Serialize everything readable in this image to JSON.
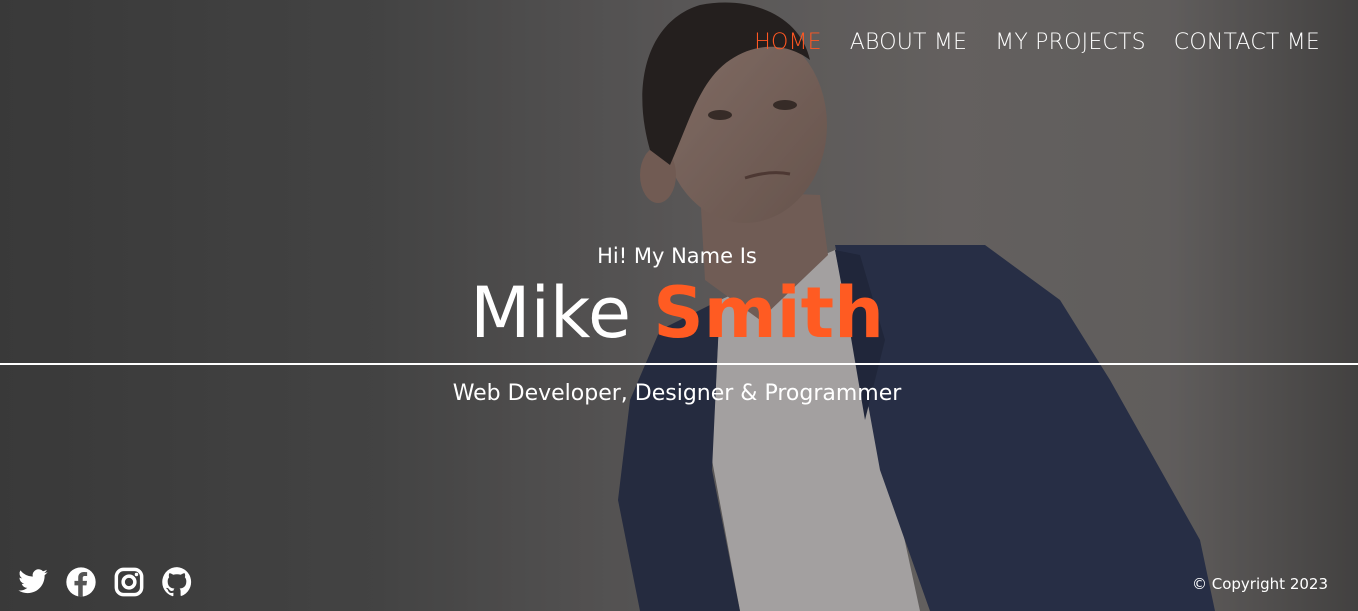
{
  "nav": {
    "items": [
      {
        "label": "HOME",
        "active": true
      },
      {
        "label": "ABOUT ME",
        "active": false
      },
      {
        "label": "MY PROJECTS",
        "active": false
      },
      {
        "label": "CONTACT ME",
        "active": false
      }
    ]
  },
  "hero": {
    "greeting": "Hi! My Name Is",
    "first_name": "Mike",
    "last_name": "Smith",
    "tagline": "Web Developer, Designer & Programmer"
  },
  "social": {
    "icons": [
      "twitter-icon",
      "facebook-icon",
      "instagram-icon",
      "github-icon"
    ]
  },
  "footer": {
    "copyright": "© Copyright 2023"
  },
  "colors": {
    "accent": "#ff5722",
    "overlay": "#3e3e3e",
    "text": "#ffffff",
    "suit": "#2c3456",
    "shirt": "#e8e4e4"
  }
}
